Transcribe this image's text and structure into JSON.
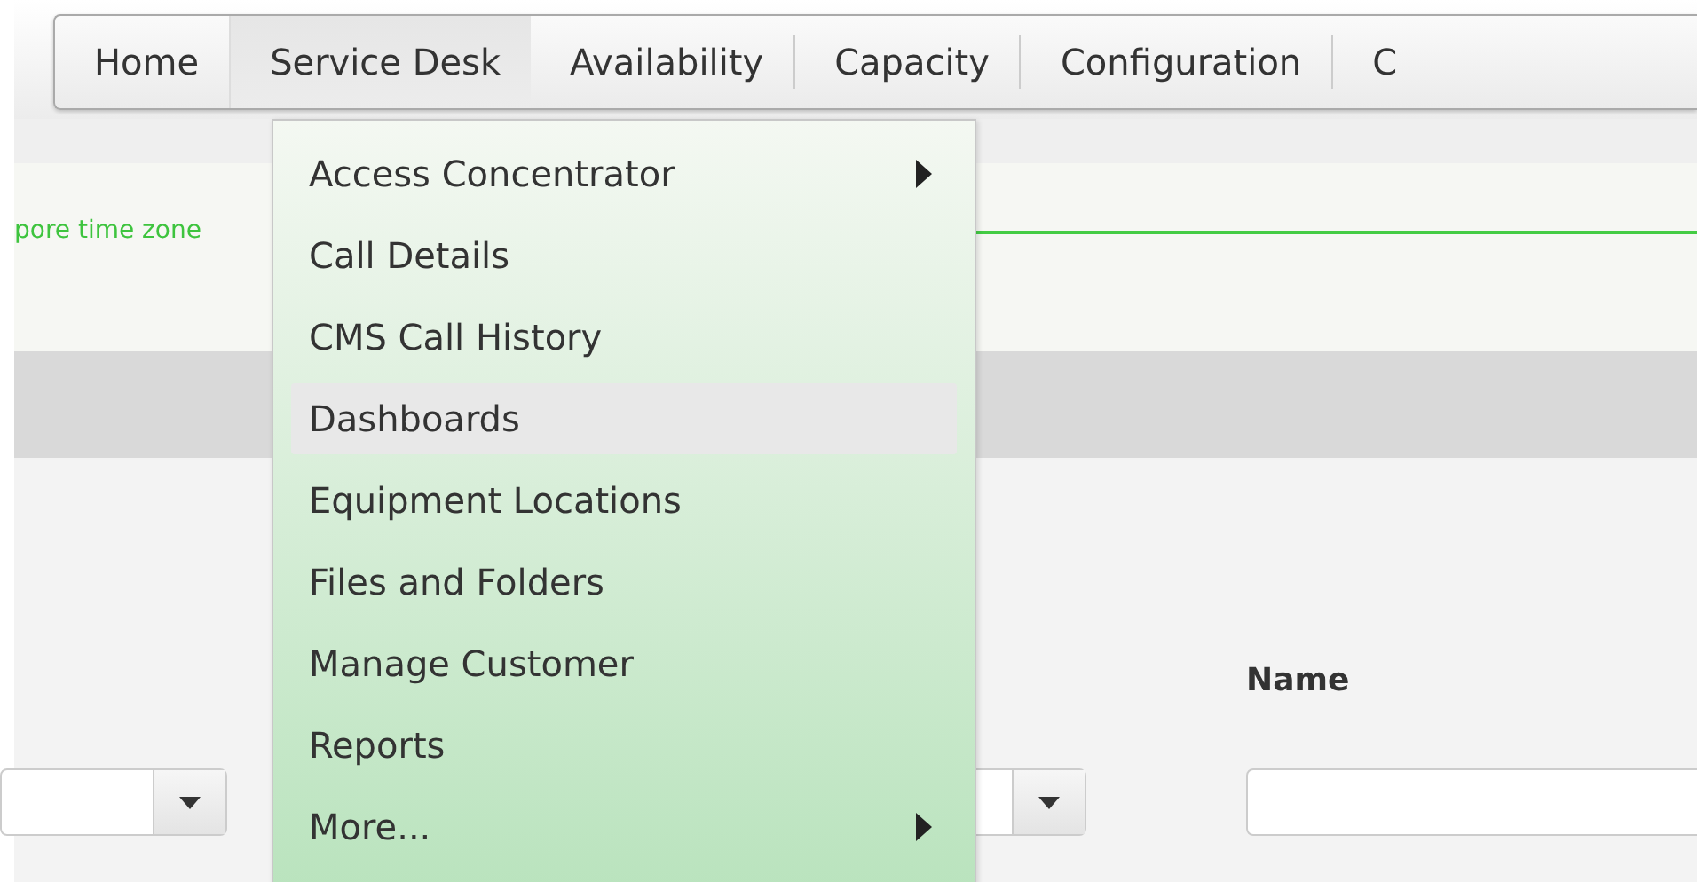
{
  "nav": [
    {
      "label": "Home",
      "selected": false
    },
    {
      "label": "Service Desk",
      "selected": true
    },
    {
      "label": "Availability",
      "selected": false
    },
    {
      "label": "Capacity",
      "selected": false
    },
    {
      "label": "Configuration",
      "selected": false
    },
    {
      "label": "C",
      "selected": false
    }
  ],
  "notice": "pore time zone",
  "menu": [
    {
      "label": "Access Concentrator",
      "submenu": true,
      "selected": false
    },
    {
      "label": "Call Details",
      "submenu": false,
      "selected": false
    },
    {
      "label": "CMS Call History",
      "submenu": false,
      "selected": false
    },
    {
      "label": "Dashboards",
      "submenu": false,
      "selected": true
    },
    {
      "label": "Equipment Locations",
      "submenu": false,
      "selected": false
    },
    {
      "label": "Files and Folders",
      "submenu": false,
      "selected": false
    },
    {
      "label": "Manage Customer",
      "submenu": false,
      "selected": false
    },
    {
      "label": "Reports",
      "submenu": false,
      "selected": false
    },
    {
      "label": "More...",
      "submenu": true,
      "selected": false
    }
  ],
  "filters": {
    "name_label": "Name"
  }
}
